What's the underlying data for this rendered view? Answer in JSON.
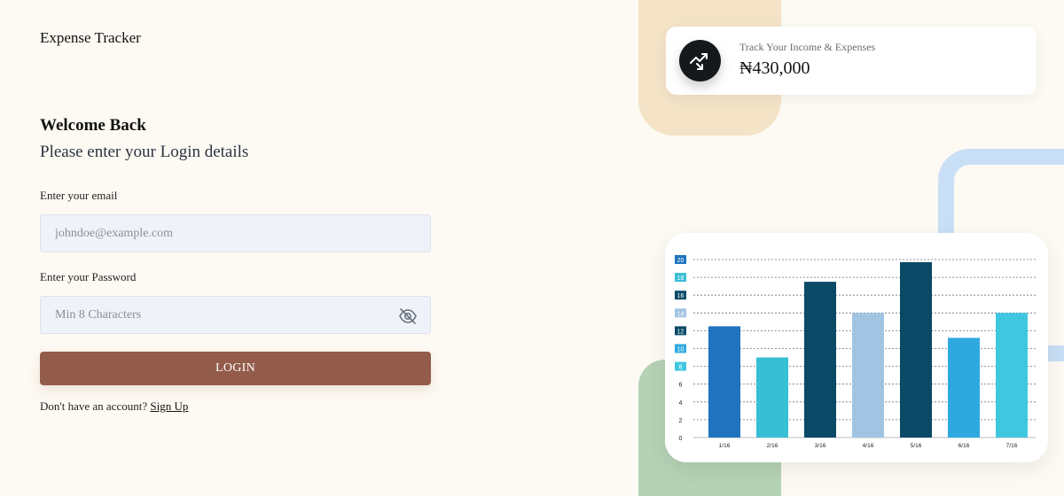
{
  "header": {
    "app_title": "Expense Tracker"
  },
  "form": {
    "welcome": "Welcome Back",
    "subtitle": "Please enter your Login details",
    "email_label": "Enter your email",
    "email_placeholder": "johndoe@example.com",
    "password_label": "Enter your Password",
    "password_placeholder": "Min 8 Characters",
    "login_label": "LOGIN",
    "signup_prompt": "Don't have an account?",
    "signup_link": "Sign Up"
  },
  "stat_card": {
    "label": "Track Your Income & Expenses",
    "value": "₦430,000",
    "icon": "trending-arrows-icon"
  },
  "colors": {
    "primary_button": "#935c4a",
    "background": "#fdfaf3",
    "input_bg": "#eff3f9"
  },
  "chart_data": {
    "type": "bar",
    "categories": [
      "1/16",
      "2/16",
      "3/16",
      "4/16",
      "5/16",
      "6/16",
      "7/16"
    ],
    "values": [
      12.5,
      9,
      17.5,
      14,
      19.7,
      11.2,
      14
    ],
    "bar_colors": [
      "#1f74bd",
      "#36bfd5",
      "#0b4a66",
      "#a2c4e3",
      "#0b4a66",
      "#2ea9e0",
      "#40c7e0"
    ],
    "ylim": [
      0,
      20
    ],
    "yticks": [
      0,
      2,
      4,
      6,
      8,
      10,
      12,
      14,
      16,
      18,
      20
    ],
    "ytick_badge_colors": {
      "8": "#40c7e0",
      "10": "#2ea9e0",
      "12": "#0b4a66",
      "14": "#a2c4e3",
      "16": "#0b4a66",
      "18": "#36bfd5",
      "20": "#1f74bd"
    },
    "grid": true,
    "title": "",
    "xlabel": "",
    "ylabel": ""
  }
}
